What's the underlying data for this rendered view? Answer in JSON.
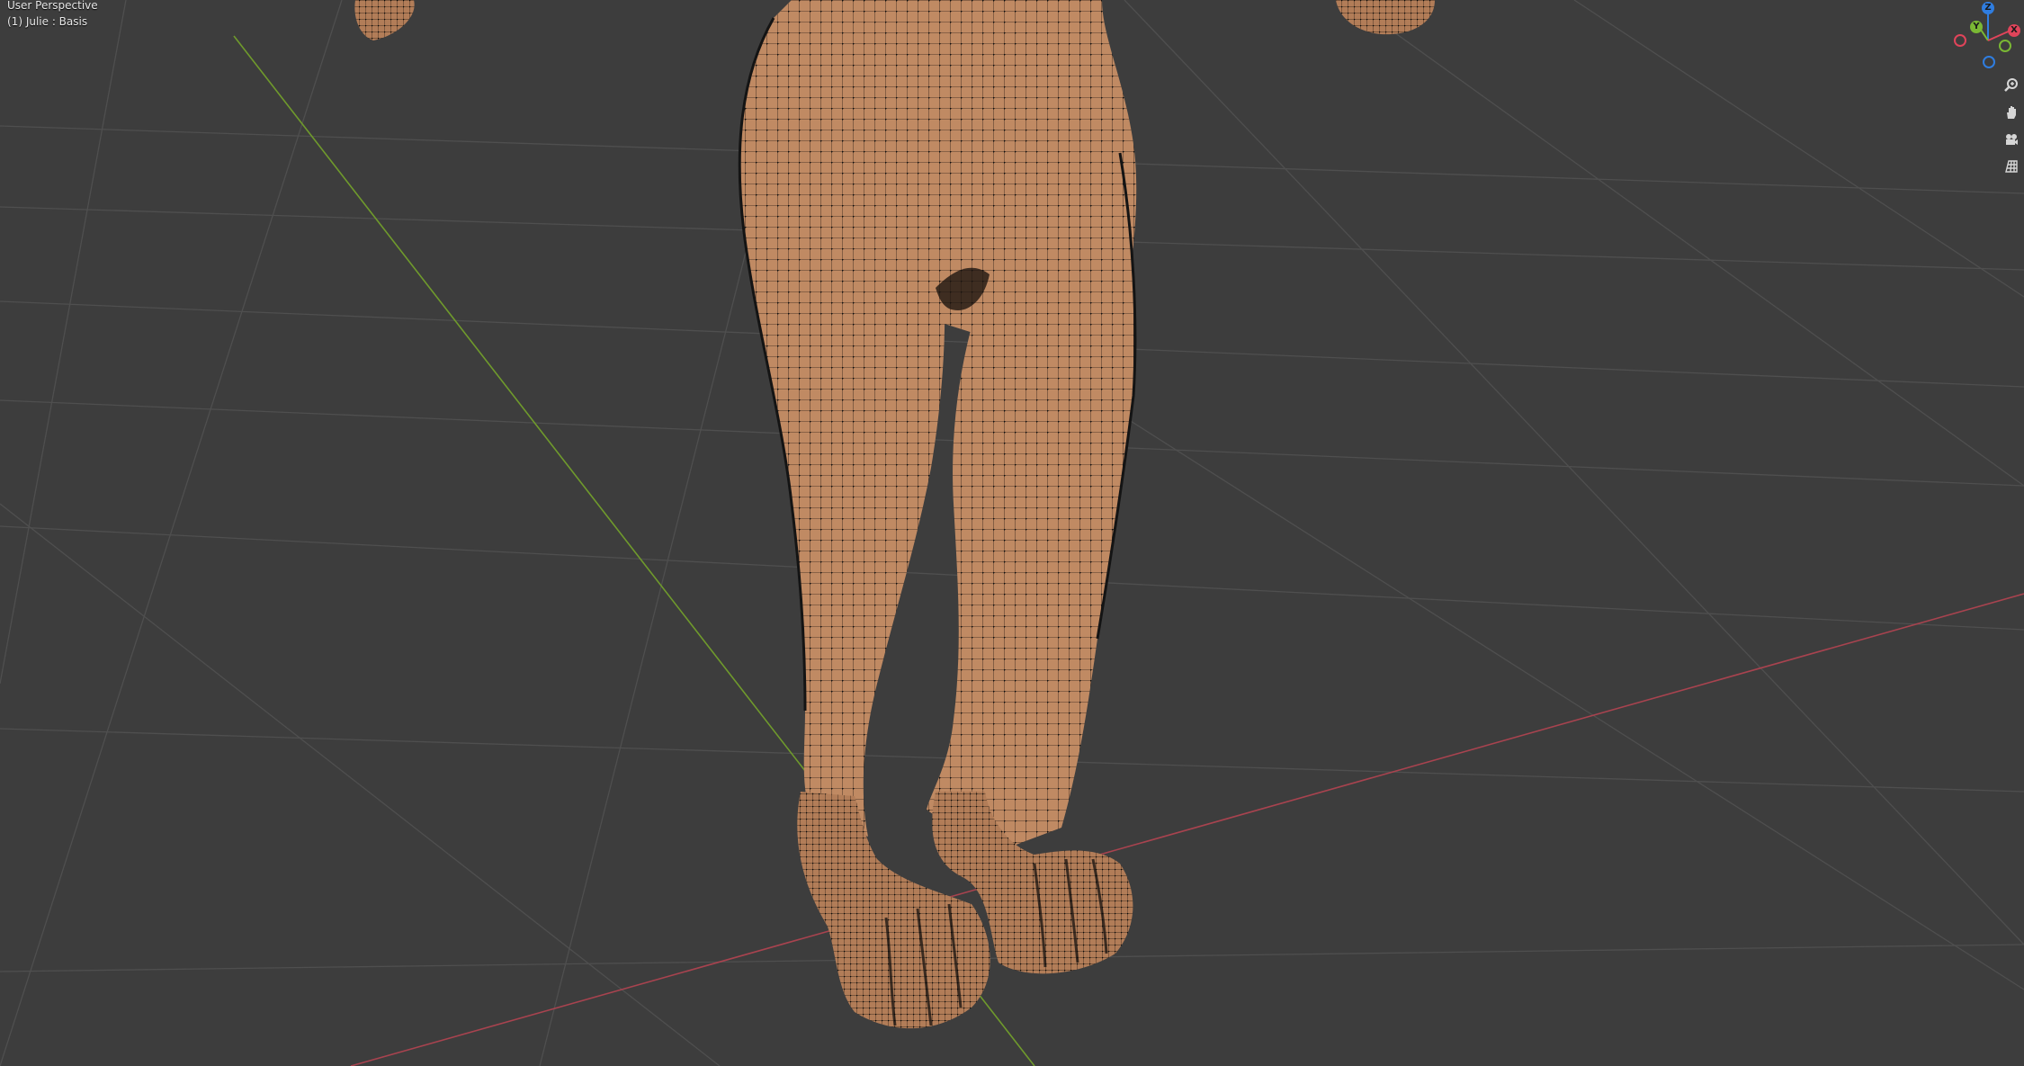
{
  "viewport": {
    "view_name": "User Perspective",
    "object_info": "(1) Julie : Basis",
    "background_color": "#3d3d3d",
    "grid_color": "#4f4f4f",
    "x_axis_color": "#a8434f",
    "y_axis_color": "#6f9a2c",
    "mesh_color": "#c08a63"
  },
  "gizmo": {
    "axes": [
      {
        "label": "Z",
        "color": "#2f7de0"
      },
      {
        "label": "Y",
        "color": "#7ab834"
      },
      {
        "label": "X",
        "color": "#e0445a"
      }
    ]
  },
  "nav_tools": [
    {
      "name": "zoom",
      "icon": "magnifier-icon"
    },
    {
      "name": "pan",
      "icon": "hand-icon"
    },
    {
      "name": "camera",
      "icon": "camera-icon"
    },
    {
      "name": "ortho",
      "icon": "grid-icon"
    }
  ]
}
